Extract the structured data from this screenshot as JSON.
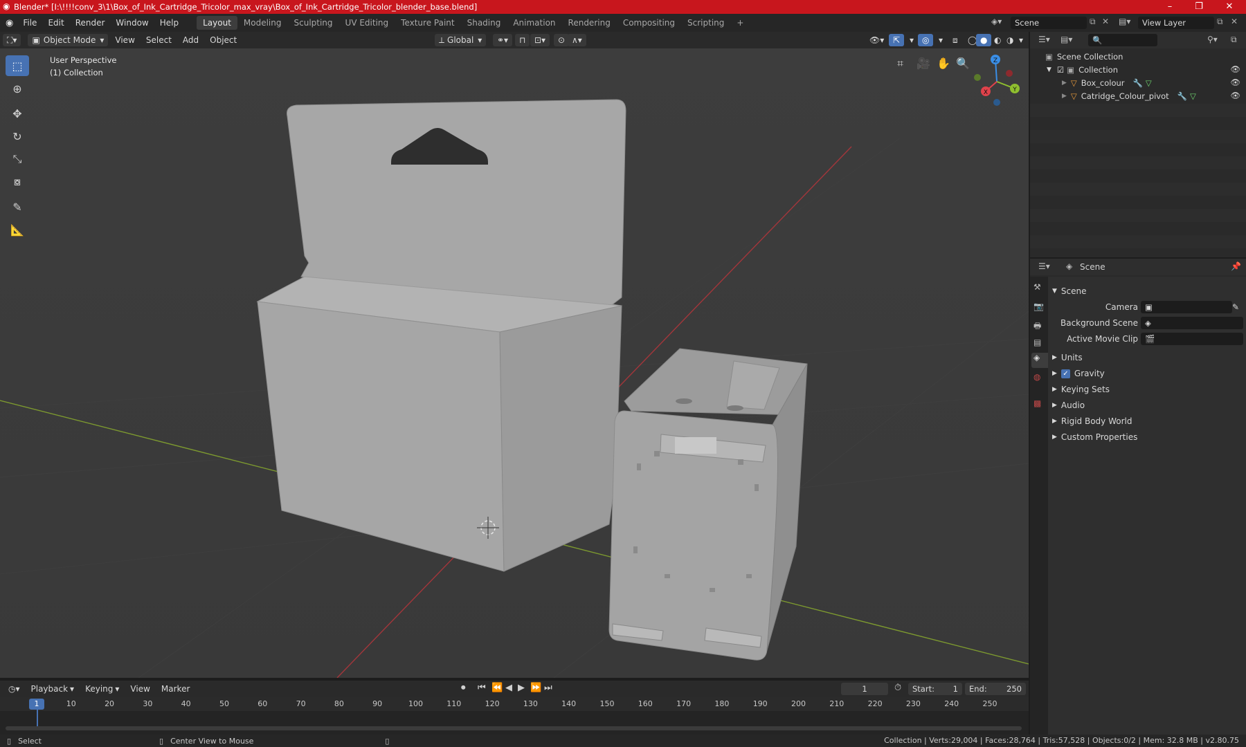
{
  "window": {
    "title": "Blender* [I:\\!!!!conv_3\\1\\Box_of_Ink_Cartridge_Tricolor_max_vray\\Box_of_Ink_Cartridge_Tricolor_blender_base.blend]",
    "minimize": "–",
    "maximize": "❐",
    "close": "✕"
  },
  "menu": [
    "File",
    "Edit",
    "Render",
    "Window",
    "Help"
  ],
  "workspaces": [
    "Layout",
    "Modeling",
    "Sculpting",
    "UV Editing",
    "Texture Paint",
    "Shading",
    "Animation",
    "Rendering",
    "Compositing",
    "Scripting"
  ],
  "workspace_add": "+",
  "scene_field": "Scene",
  "view_layer_field": "View Layer",
  "viewport_header": {
    "mode": "Object Mode",
    "menus": [
      "View",
      "Select",
      "Add",
      "Object"
    ],
    "transform_orientation": "Global"
  },
  "viewport": {
    "perspective_label": "User Perspective",
    "collection_label": "(1) Collection",
    "gizmo": {
      "x": "X",
      "y": "Y",
      "z": "Z"
    }
  },
  "outliner": {
    "root": "Scene Collection",
    "collection": "Collection",
    "objects": [
      "Box_colour",
      "Catridge_Colour_pivot"
    ]
  },
  "properties": {
    "header": "Scene",
    "panel_title": "Scene",
    "camera_label": "Camera",
    "background_scene_label": "Background Scene",
    "active_movie_clip_label": "Active Movie Clip",
    "sections": [
      "Units",
      "Gravity",
      "Keying Sets",
      "Audio",
      "Rigid Body World",
      "Custom Properties"
    ]
  },
  "timeline": {
    "menus": [
      "Playback",
      "Keying",
      "View",
      "Marker"
    ],
    "current_frame": "1",
    "start_label": "Start:",
    "start": "1",
    "end_label": "End:",
    "end": "250",
    "ruler": [
      "1",
      "10",
      "20",
      "30",
      "40",
      "50",
      "60",
      "70",
      "80",
      "90",
      "100",
      "110",
      "120",
      "130",
      "140",
      "150",
      "160",
      "170",
      "180",
      "190",
      "200",
      "210",
      "220",
      "230",
      "240",
      "250"
    ]
  },
  "statusbar": {
    "select": "Select",
    "center_view": "Center View to Mouse",
    "stats": "Collection | Verts:29,004 | Faces:28,764 | Tris:57,528 | Objects:0/2 | Mem: 32.8 MB | v2.80.75"
  },
  "colors": {
    "titlebar": "#c8161d",
    "active_tool": "#4772b3",
    "axis_x": "#e0424b",
    "axis_y": "#8fbf2f",
    "axis_z": "#3a8ee6",
    "object_icon": "#e89a3c",
    "modifier_icon": "#6fa8dc",
    "mesh_icon": "#6fd36f"
  }
}
